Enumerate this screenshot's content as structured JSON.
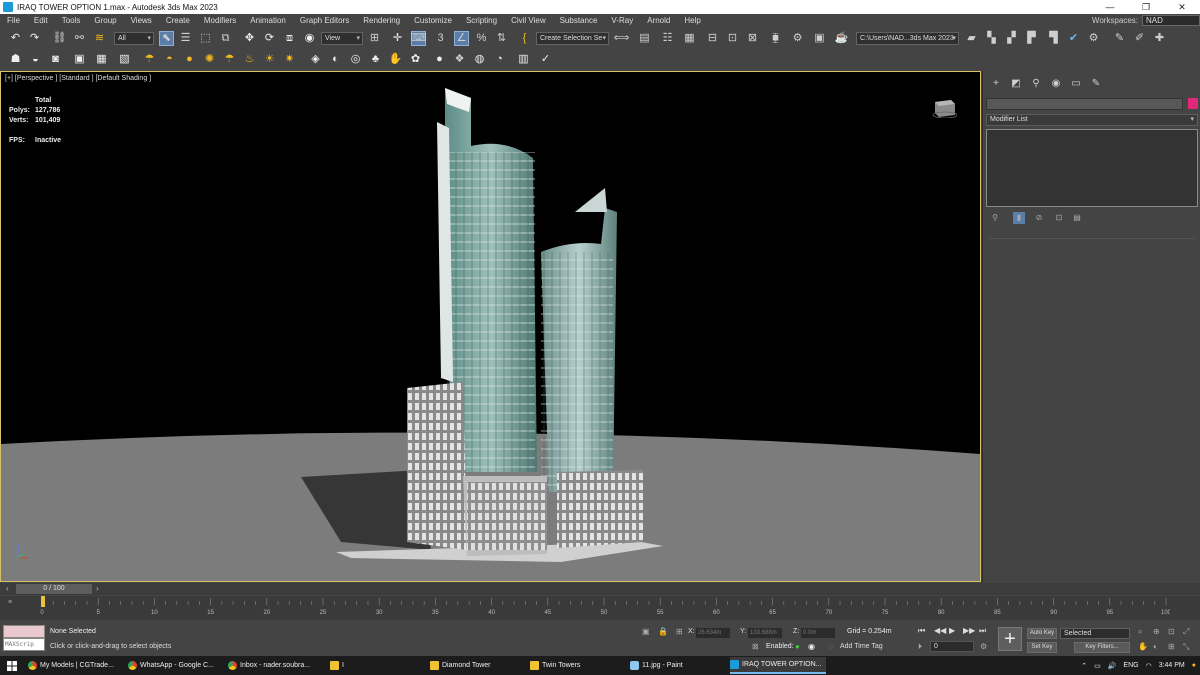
{
  "window": {
    "title": "IRAQ TOWER OPTION 1.max - Autodesk 3ds Max 2023",
    "minimize": "—",
    "maximize": "❐",
    "close": "✕"
  },
  "menu": {
    "items": [
      "File",
      "Edit",
      "Tools",
      "Group",
      "Views",
      "Create",
      "Modifiers",
      "Animation",
      "Graph Editors",
      "Rendering",
      "Customize",
      "Scripting",
      "Civil View",
      "Substance",
      "V-Ray",
      "Arnold",
      "Help"
    ],
    "workspaces_label": "Workspaces:",
    "workspaces_value": "NAD"
  },
  "toolbar": {
    "selection_filter": "All",
    "ref_coord": "View",
    "named_selection_set": "Create Selection Se",
    "project_path": "C:\\Users\\NAD...3ds Max 2023"
  },
  "viewport": {
    "label": "[+] [Perspective ] [Standard ] [Default Shading ]",
    "stats": {
      "header": "Total",
      "polys_label": "Polys:",
      "polys_value": "127,786",
      "verts_label": "Verts:",
      "verts_value": "101,409",
      "fps_label": "FPS:",
      "fps_value": "Inactive"
    }
  },
  "command_panel": {
    "modifier_list": "Modifier List",
    "object_color": "#e0287a"
  },
  "timeline": {
    "frame_display": "0 / 100",
    "ticks": [
      "0",
      "5",
      "10",
      "15",
      "20",
      "25",
      "30",
      "35",
      "40",
      "45",
      "50",
      "55",
      "60",
      "65",
      "70",
      "75",
      "80",
      "85",
      "90",
      "95",
      "100"
    ]
  },
  "status": {
    "maxscript_label": "MAXScrip",
    "selection": "None Selected",
    "prompt": "Click or click-and-drag to select objects",
    "x_label": "X:",
    "x_value": "26.634m",
    "y_label": "Y:",
    "y_value": "133.688m",
    "z_label": "Z:",
    "z_value": "0.0m",
    "grid": "Grid = 0.254m",
    "enabled": "Enabled:",
    "add_time_tag": "Add Time Tag",
    "auto_key": "Auto Key",
    "set_key": "Set Key",
    "selected_set": "Selected",
    "key_filters": "Key Filters...",
    "frame_value": "0"
  },
  "taskbar": {
    "items": [
      {
        "label": "My Models | CGTrade...",
        "icon_color": "#e8b64b",
        "kind": "chrome"
      },
      {
        "label": "WhatsApp - Google C...",
        "icon_color": "#e8b64b",
        "kind": "chrome"
      },
      {
        "label": "Inbox - nader.soubra...",
        "icon_color": "#e8b64b",
        "kind": "chrome"
      },
      {
        "label": "I",
        "kind": "folder"
      },
      {
        "label": "Diamond Tower",
        "kind": "folder"
      },
      {
        "label": "Twin Towers",
        "kind": "folder"
      },
      {
        "label": "11.jpg - Paint",
        "icon_color": "#8fc7ef",
        "kind": "app"
      },
      {
        "label": "IRAQ TOWER OPTION...",
        "icon_color": "#1a9bd8",
        "kind": "app"
      }
    ],
    "language": "ENG",
    "time": "3:44 PM"
  }
}
